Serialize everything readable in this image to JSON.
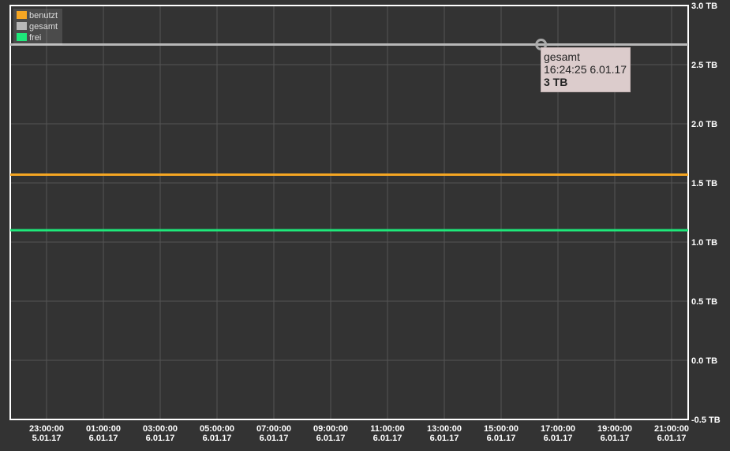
{
  "chart_data": {
    "type": "line",
    "y_ticks": [
      "3.0 TB",
      "2.5 TB",
      "2.0 TB",
      "1.5 TB",
      "1.0 TB",
      "0.5 TB",
      "0.0 TB",
      "-0.5 TB"
    ],
    "y_tick_values": [
      3.0,
      2.5,
      2.0,
      1.5,
      1.0,
      0.5,
      0.0,
      -0.5
    ],
    "ylim": [
      -0.5,
      3.0
    ],
    "x_ticks": [
      {
        "time": "23:00:00",
        "date": "5.01.17"
      },
      {
        "time": "01:00:00",
        "date": "6.01.17"
      },
      {
        "time": "03:00:00",
        "date": "6.01.17"
      },
      {
        "time": "05:00:00",
        "date": "6.01.17"
      },
      {
        "time": "07:00:00",
        "date": "6.01.17"
      },
      {
        "time": "09:00:00",
        "date": "6.01.17"
      },
      {
        "time": "11:00:00",
        "date": "6.01.17"
      },
      {
        "time": "13:00:00",
        "date": "6.01.17"
      },
      {
        "time": "15:00:00",
        "date": "6.01.17"
      },
      {
        "time": "17:00:00",
        "date": "6.01.17"
      },
      {
        "time": "19:00:00",
        "date": "6.01.17"
      },
      {
        "time": "21:00:00",
        "date": "6.01.17"
      }
    ],
    "grid": true,
    "legend_position": "top-left",
    "series": [
      {
        "name": "benutzt",
        "color": "#f5a623",
        "value": 1.57
      },
      {
        "name": "gesamt",
        "color": "#b8b8b8",
        "value": 2.67
      },
      {
        "name": "frei",
        "color": "#1ee87a",
        "value": 1.1
      }
    ],
    "tooltip": {
      "series": "gesamt",
      "timestamp": "16:24:25 6.01.17",
      "value_label": "3 TB",
      "x_time": "16:24:25",
      "y_value": 2.67
    }
  }
}
